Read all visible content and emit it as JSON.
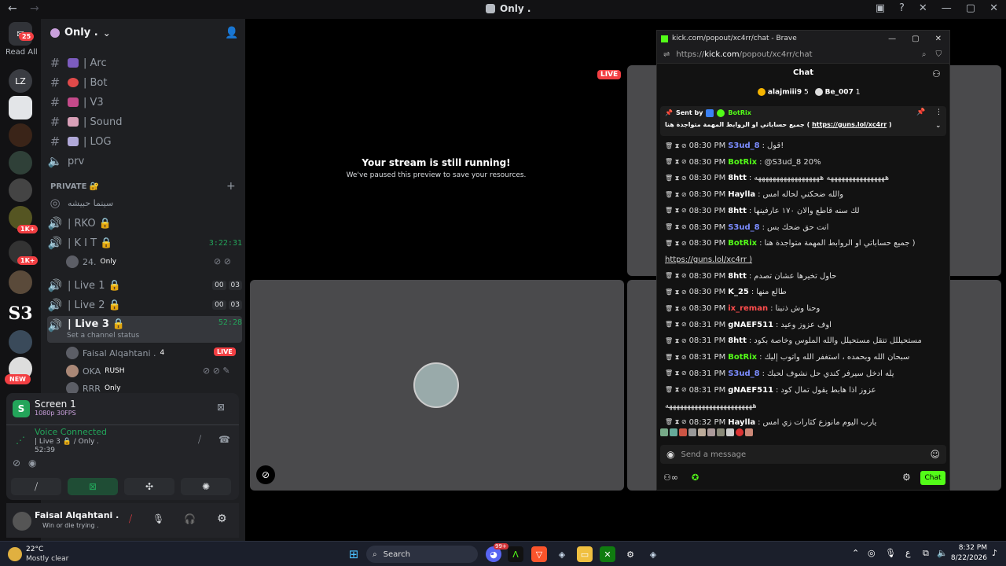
{
  "window": {
    "title": "Only .",
    "back": "←",
    "forward": "→"
  },
  "rail": {
    "read_all": "Read All",
    "unread_badge": "25",
    "badge_1k_a": "1K+",
    "badge_1k_b": "1K+",
    "s3_label": "S3",
    "new_badge": "NEW"
  },
  "server": {
    "name": "Only .",
    "chevron": "⌄"
  },
  "channels": [
    {
      "label": "| Arc"
    },
    {
      "label": "| Bot"
    },
    {
      "label": "| V3"
    },
    {
      "label": "| Sound"
    },
    {
      "label": "| LOG"
    },
    {
      "label": "prv"
    }
  ],
  "private_header": "PRIVATE 🔐",
  "voice_channels": {
    "cinema": "سينما حبيشه",
    "rko": "| RKO",
    "kit": "| K I T",
    "kit_timer": "3:22:31",
    "kit_user": "24.",
    "kit_user_tag": "Only",
    "live1": "| Live 1",
    "live1_counts": [
      "00",
      "03"
    ],
    "live2": "| Live 2",
    "live2_counts": [
      "00",
      "03"
    ],
    "live3": "| Live 3",
    "live3_timer": "52:28",
    "live3_status": "Set a channel status",
    "members": [
      {
        "name": "Faisal Alqahtani .",
        "tag": "4",
        "live": "LIVE"
      },
      {
        "name": "OKA",
        "tag": "RUSH"
      },
      {
        "name": "RRR",
        "tag": "Only"
      }
    ]
  },
  "screen_panel": {
    "title": "Screen 1",
    "quality": "1080p 30FPS"
  },
  "voice_panel": {
    "status": "Voice Connected",
    "channel": "| Live 3 🔒 / Only .",
    "timer": "52:39"
  },
  "user_panel": {
    "name": "Faisal Alqahtani .",
    "status": "Win or die trying ."
  },
  "stage": {
    "paused_title": "Your stream is still running!",
    "paused_sub": "We've paused this preview to save your resources.",
    "live_badge": "LIVE"
  },
  "popout": {
    "window_title": "kick.com/popout/xc4rr/chat - Brave",
    "url_prefix": "https://",
    "url_domain": "kick.com",
    "url_path": "/popout/xc4rr/chat",
    "chat_title": "Chat",
    "top_gifters": [
      {
        "name": "alajmiii9",
        "count": "5"
      },
      {
        "name": "Be_007",
        "count": "1"
      }
    ],
    "pinned_by": "Sent by",
    "pinned_user": "BotRix",
    "pinned_text": "جميع حساباتي او الروابط المهمة متواجدة هنا (",
    "pinned_link": "https://guns.lol/xc4rr",
    "pinned_close": ")",
    "messages": [
      {
        "time": "08:30 PM",
        "user": "S3ud_8",
        "color": "#7b8cff",
        "text": "قول!"
      },
      {
        "time": "08:30 PM",
        "user": "BotRix",
        "color": "#53fc18",
        "text": "@S3ud_8 20%"
      },
      {
        "time": "08:30 PM",
        "user": "8htt",
        "color": "#ffffff",
        "text": "ههههههههههههههههه ههههههههههههههههههه"
      },
      {
        "time": "08:30 PM",
        "user": "Haylla",
        "color": "#ffffff",
        "text": "والله ضحكني لحاله امس"
      },
      {
        "time": "08:30 PM",
        "user": "8htt",
        "color": "#ffffff",
        "text": "لك سنه قاطع والان ١٧٠ عارفينها"
      },
      {
        "time": "08:30 PM",
        "user": "S3ud_8",
        "color": "#7b8cff",
        "text": "انت حق ضحك بس"
      },
      {
        "time": "08:30 PM",
        "user": "BotRix",
        "color": "#53fc18",
        "text": "جميع حساباتي او الروابط المهمة متواجدة هنا )"
      },
      {
        "time": "",
        "user": "",
        "color": "#ffffff",
        "text": "https://guns.lol/xc4rr )"
      },
      {
        "time": "08:30 PM",
        "user": "8htt",
        "color": "#ffffff",
        "text": "حاول تخيرها عشان تصدم"
      },
      {
        "time": "08:30 PM",
        "user": "K_25",
        "color": "#ffffff",
        "text": "طالع منها"
      },
      {
        "time": "08:30 PM",
        "user": "ix_reman",
        "color": "#ff4d4d",
        "text": "وحنا وش ذنبنا"
      },
      {
        "time": "08:31 PM",
        "user": "gNAEF511",
        "color": "#ffffff",
        "text": "اوف عزوز وعيد"
      },
      {
        "time": "08:31 PM",
        "user": "8htt",
        "color": "#ffffff",
        "text": "مستحيللل تتقل مستحيلل والله الملوس وخاصة بكود"
      },
      {
        "time": "08:31 PM",
        "user": "BotRix",
        "color": "#53fc18",
        "text": "سبحان الله وبحمده ، استغفر الله واتوب إليك"
      },
      {
        "time": "08:31 PM",
        "user": "S3ud_8",
        "color": "#7b8cff",
        "text": "يله ادخل سيرفر كندي حل نشوف لحبك"
      },
      {
        "time": "08:31 PM",
        "user": "gNAEF511",
        "color": "#ffffff",
        "text": "عزوز اذا هابط يقول تمال كود"
      },
      {
        "time": "",
        "user": "",
        "color": "#ffffff",
        "text": "ههههههههههههههههههههههههه"
      },
      {
        "time": "08:32 PM",
        "user": "Haylla",
        "color": "#ffffff",
        "text": "يارب اليوم مانوزع كثارات زي امس"
      }
    ],
    "input_placeholder": "Send a message",
    "chat_button": "Chat"
  },
  "taskbar": {
    "temp": "22°C",
    "weather": "Mostly clear",
    "search": "Search",
    "time": "8:32 PM",
    "date": "8/22/2026",
    "lang": "ع",
    "notif_badge": "99+"
  }
}
